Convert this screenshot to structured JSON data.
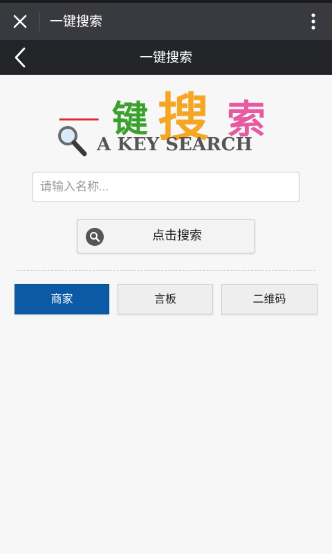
{
  "wechat_bar": {
    "title": "一键搜索",
    "close_icon": "close-icon",
    "more_icon": "more-vertical-icon"
  },
  "header": {
    "title": "一键搜索",
    "back_icon": "chevron-left-icon"
  },
  "logo": {
    "chars": [
      "一",
      "键",
      "搜",
      "索"
    ],
    "subtitle": "A KEY SEARCH",
    "icon": "magnifier-icon"
  },
  "search": {
    "placeholder": "请输入名称...",
    "value": "",
    "button_label": "点击搜索",
    "button_icon": "search-icon"
  },
  "tabs": [
    {
      "label": "商家",
      "active": true
    },
    {
      "label": "言板",
      "active": false
    },
    {
      "label": "二维码",
      "active": false
    }
  ],
  "colors": {
    "wechat_bar": "#393a3f",
    "header": "#222427",
    "active_tab": "#0c5aa6"
  }
}
